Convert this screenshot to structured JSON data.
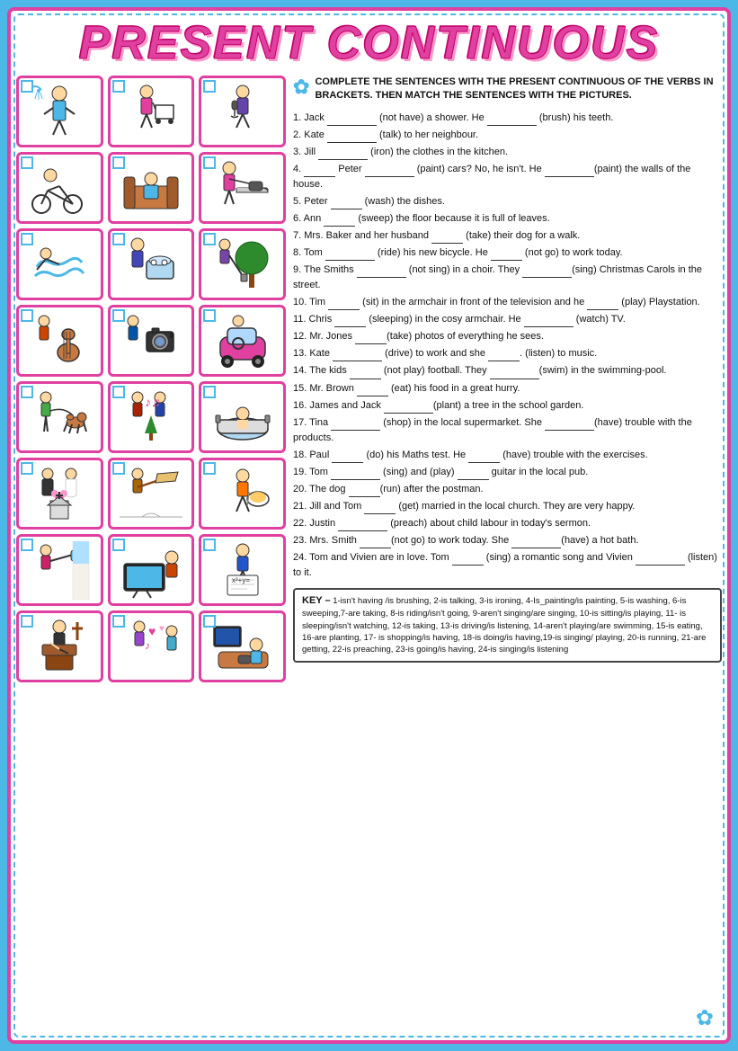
{
  "title": "PRESENT CONTINUOUS",
  "instruction": "Complete the sentences with the present continuous of the verbs in brackets. Then match the sentences with the pictures.",
  "sentences": [
    "1. Jack _______ (not have) a shower. He _______ (brush) his teeth.",
    "2. Kate _________ (talk) to her neighbour.",
    "3. Jill __________ (iron) the clothes in the kitchen.",
    "4. _____ Peter ________ (paint) cars? No, he isn't. He __________(paint) the walls of the house.",
    "5. Peter ______ (wash) the dishes.",
    "6. Ann ______ (sweep) the floor because it is full of leaves.",
    "7. Mrs. Baker and her husband ______ (take) their dog for a walk.",
    "8. Tom ________ (ride) his new bicycle. He ______ (not go) to work today.",
    "9. The Smiths ________ (not sing) in a choir. They ________(sing) Christmas Carols in the street.",
    "10. Tim _______ (sit) in the armchair in front of the television and he _____ (play) Playstation.",
    "11. Chris _______ (sleeping) in the cosy armchair. He _________ (watch) TV.",
    "12. Mr. Jones _______(take) photos of everything he sees.",
    "13. Kate ________ (drive) to work and she ______. (listen) to music.",
    "14. The kids ______ (not play) football. They ________(swim) in the swimming-pool.",
    "15. Mr. Brown _______ (eat) his food in a great hurry.",
    "16. James and Jack __________(plant) a tree in the school garden.",
    "17. Tina ________ (shop) in the local supermarket. She _________(have) trouble with the products.",
    "18. Paul _______ (do) his Maths test. He ______ (have) trouble with the exercises.",
    "19. Tom ________ (sing) and (play) _______ guitar in the local pub.",
    "20. The dog _______(run) after the postman.",
    "21. Jill and Tom _______ (get) married in the local church. They are very happy.",
    "22. Justin ________ (preach) about child labour in today's sermon.",
    "23. Mrs. Smith _______(not go) to work today. She ________(have) a hot bath.",
    "24. Tom and Vivien are in love. Tom _______ (sing) a romantic song and Vivien _________ (listen) to it."
  ],
  "key_label": "KEY –",
  "key_text": "1-isn't having /is brushing, 2-is talking, 3-is ironing, 4-Is_painting/is painting, 5-is washing, 6-is sweeping,7-are taking, 8-is riding/isn't going, 9-aren't singing/are singing, 10-is sitting/is playing, 11- is sleeping/isn't watching, 12-is taking, 13-is driving/is listening, 14-aren't playing/are swimming, 15-is eating, 16-are planting, 17- is shopping/is having, 18-is doing/is having,19-is singing/ playing, 20-is running, 21-are getting, 22-is preaching, 23-is going/is having, 24-is singing/is listening",
  "images": [
    {
      "emoji": "🚿",
      "label": "shower scene"
    },
    {
      "emoji": "🛒",
      "label": "shopping"
    },
    {
      "emoji": "🎤",
      "label": "singing"
    },
    {
      "emoji": "🚲",
      "label": "cycling"
    },
    {
      "emoji": "🛋️",
      "label": "armchair"
    },
    {
      "emoji": "👔",
      "label": "ironing"
    },
    {
      "emoji": "🏊",
      "label": "swimming"
    },
    {
      "emoji": "🍽️",
      "label": "dishes"
    },
    {
      "emoji": "🌳",
      "label": "tree planting"
    },
    {
      "emoji": "🎸",
      "label": "guitar"
    },
    {
      "emoji": "📸",
      "label": "photos"
    },
    {
      "emoji": "🚗",
      "label": "driving"
    },
    {
      "emoji": "🐕",
      "label": "dog walk"
    },
    {
      "emoji": "🎄",
      "label": "christmas"
    },
    {
      "emoji": "🛁",
      "label": "bath"
    },
    {
      "emoji": "🎂",
      "label": "wedding"
    },
    {
      "emoji": "🧹",
      "label": "sweeping"
    },
    {
      "emoji": "🎵",
      "label": "singing pub"
    },
    {
      "emoji": "🏠",
      "label": "painting house"
    },
    {
      "emoji": "🍔",
      "label": "eating"
    },
    {
      "emoji": "📺",
      "label": "watching tv"
    },
    {
      "emoji": "📝",
      "label": "maths test"
    },
    {
      "emoji": "🎸",
      "label": "guitar 2"
    },
    {
      "emoji": "⛪",
      "label": "church"
    }
  ]
}
